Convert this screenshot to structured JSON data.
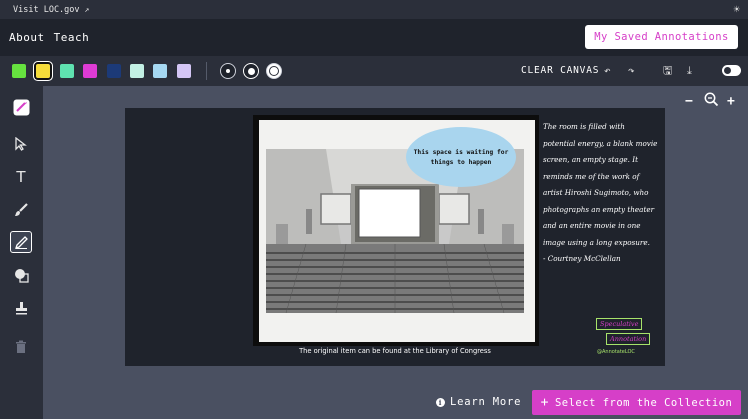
{
  "topbar": {
    "visit_label": "Visit LOC.gov",
    "external_icon": "external-link-icon",
    "theme_icon": "sun-icon"
  },
  "nav": {
    "about": "About",
    "teach": "Teach",
    "saved_button": "My Saved Annotations"
  },
  "toolbar": {
    "colors": [
      "#66e23f",
      "#f5dc3a",
      "#5fe2b0",
      "#de3bd4",
      "#1c3a78",
      "#c3f0e4",
      "#a6d8f2",
      "#d4c6f5"
    ],
    "selected_color_index": 1,
    "clear_label": "CLEAR CANVAS",
    "undo_icon": "undo-icon",
    "redo_icon": "redo-icon",
    "save_icon": "save-icon",
    "download_icon": "download-icon",
    "toggle_state": "off"
  },
  "sidebar": {
    "tools": [
      "annotate-logo-icon",
      "select-arrow-icon",
      "text-icon",
      "paintbrush-icon",
      "marker-pen-icon",
      "shapes-icon",
      "stamp-icon",
      "trash-icon"
    ],
    "active_tool": "marker-pen-icon"
  },
  "zoom": {
    "out_icon": "minus-icon",
    "reset_icon": "zoom-magnifier-icon",
    "in_icon": "plus-icon"
  },
  "canvas": {
    "bubble_text": "This space is waiting for things to happen",
    "handwritten_note": "The room is filled with potential energy, a blank movie screen, an empty stage. It reminds me of the work of artist Hiroshi Sugimoto, who photographs an empty theater and an entire movie in one image using a long exposure.\n- Courtney McClellan",
    "caption": "The original item can be found at the Library of Congress",
    "stamp": {
      "line1": "Speculative",
      "line2": "Annotation",
      "tag": "@AnnotateLOC"
    }
  },
  "footer": {
    "learn_more": "Learn More",
    "select_button": "Select from the Collection",
    "plus": "+"
  }
}
